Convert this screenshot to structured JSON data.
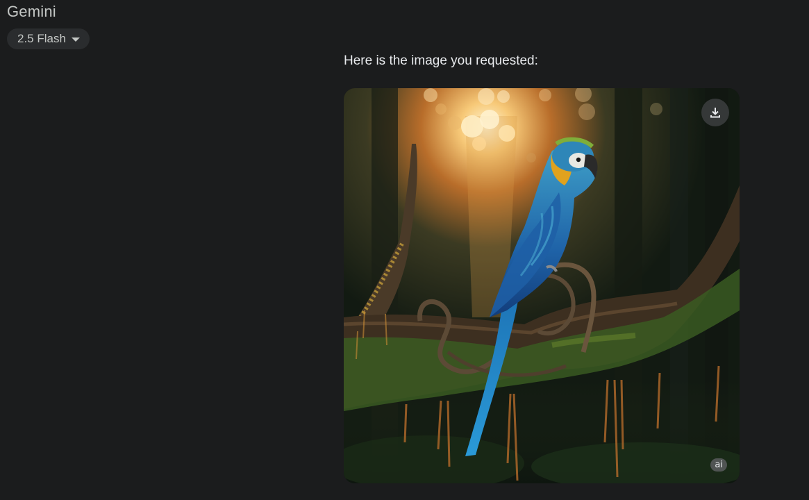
{
  "header": {
    "app_title": "Gemini",
    "model_selector": {
      "label": "2.5 Flash",
      "icon": "caret-down-icon"
    }
  },
  "conversation": {
    "response_text": "Here is the image you requested:",
    "generated_image": {
      "subject": "blue-and-yellow macaw on mossy branch",
      "download_icon": "download-icon",
      "badge_label": "ai"
    }
  },
  "colors": {
    "background": "#1b1c1d",
    "chip_background": "#2a2c2e",
    "text_primary": "#e8eaed",
    "text_secondary": "#c4c7c5"
  }
}
